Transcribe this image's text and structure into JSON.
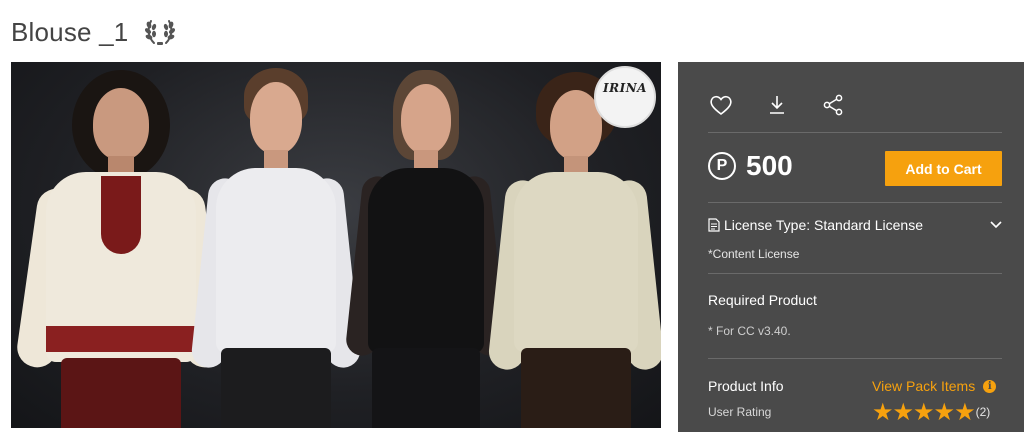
{
  "product": {
    "title": "Blouse _1",
    "badge_icon": "laurel-wreath-icon"
  },
  "preview": {
    "logo_text": "IRINA"
  },
  "actions": {
    "icons": [
      "heart-icon",
      "download-icon",
      "share-icon"
    ]
  },
  "purchase": {
    "currency_symbol": "P",
    "price": "500",
    "add_to_cart_label": "Add to Cart",
    "accent_color": "#f6a10e"
  },
  "license": {
    "type_label": "License Type: Standard License",
    "sub_label": "*Content License"
  },
  "required": {
    "title": "Required Product",
    "note": "* For CC v3.40."
  },
  "info": {
    "title": "Product Info",
    "pack_link": "View Pack Items",
    "rating_label": "User Rating",
    "rating_stars": 5,
    "rating_count": "(2)"
  }
}
